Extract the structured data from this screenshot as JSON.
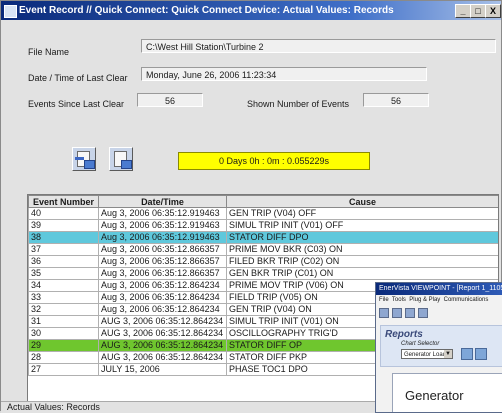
{
  "window": {
    "title": "Event Record // Quick Connect: Quick Connect Device: Actual Values: Records",
    "controls": [
      "_",
      "□",
      "X"
    ]
  },
  "fields": {
    "file_name_label": "File Name",
    "file_name_value": "C:\\West Hill Station\\Turbine 2",
    "last_clear_label": "Date / Time of Last Clear",
    "last_clear_value": "Monday, June 26, 2006 11:23:34",
    "events_since_label": "Events Since Last Clear",
    "events_since_value": "56",
    "shown_events_label": "Shown Number of Events",
    "shown_events_value": "56"
  },
  "toolbar": {
    "icons": [
      "save-record-icon",
      "export-record-icon"
    ],
    "timer": "0 Days 0h : 0m : 0.055229s"
  },
  "table": {
    "columns": [
      "Event Number",
      "Date/Time",
      "Cause"
    ],
    "rows": [
      {
        "num": "40",
        "dt": "Aug 3, 2006 06:35:12.919463",
        "cause": "GEN TRIP (V04) OFF",
        "hl": ""
      },
      {
        "num": "39",
        "dt": "Aug 3, 2006 06:35:12.919463",
        "cause": "SIMUL TRIP INIT (V01) OFF",
        "hl": ""
      },
      {
        "num": "38",
        "dt": "Aug 3, 2006 06:35:12.919463",
        "cause": "STATOR DIFF DPO",
        "hl": "cyan"
      },
      {
        "num": "37",
        "dt": "Aug 3, 2006 06:35:12.866357",
        "cause": "PRIME MOV BKR (C03) ON",
        "hl": ""
      },
      {
        "num": "36",
        "dt": "Aug 3, 2006 06:35:12.866357",
        "cause": "FILED BKR TRIP (C02) ON",
        "hl": ""
      },
      {
        "num": "35",
        "dt": "Aug 3, 2006 06:35:12.866357",
        "cause": "GEN BKR TRIP (C01) ON",
        "hl": ""
      },
      {
        "num": "34",
        "dt": "Aug 3, 2006 06:35:12.864234",
        "cause": "PRIME MOV TRIP (V06) ON",
        "hl": ""
      },
      {
        "num": "33",
        "dt": "Aug 3, 2006 06:35:12.864234",
        "cause": "FIELD TRIP (V05) ON",
        "hl": ""
      },
      {
        "num": "32",
        "dt": "Aug 3, 2006 06:35:12.864234",
        "cause": "GEN TRIP (V04) ON",
        "hl": ""
      },
      {
        "num": "31",
        "dt": "AUG 3, 2006 06:35:12.864234",
        "cause": "SIMUL TRIP INIT (V01) ON",
        "hl": ""
      },
      {
        "num": "30",
        "dt": "AUG 3, 2006 06:35:12.864234",
        "cause": "OSCILLOGRAPHY TRIG'D",
        "hl": ""
      },
      {
        "num": "29",
        "dt": "AUG 3, 2006 06:35:12.864234",
        "cause": "STATOR DIFF OP",
        "hl": "green"
      },
      {
        "num": "28",
        "dt": "AUG 3, 2006 06:35:12.864234",
        "cause": "STATOR DIFF PKP",
        "hl": ""
      },
      {
        "num": "27",
        "dt": "JULY 15, 2006",
        "cause": "PHASE TOC1 DPO",
        "hl": ""
      }
    ]
  },
  "status": {
    "text": "Actual Values: Records"
  },
  "second_window": {
    "title": "EnerVista VIEWPOINT - [Report 1_1105",
    "menu": [
      "File",
      "Tools",
      "Plug & Play",
      "Communications"
    ],
    "reports_label": "Reports",
    "chart_selector_label": "Chart Selector",
    "chart_selector_value": "Generator Load",
    "panel_text": "Generator"
  },
  "colors": {
    "highlight_cyan": "#5fc8dc",
    "highlight_green": "#6fc62e",
    "timer_bg": "#ffff00",
    "titlebar": "#0a2a7a"
  }
}
